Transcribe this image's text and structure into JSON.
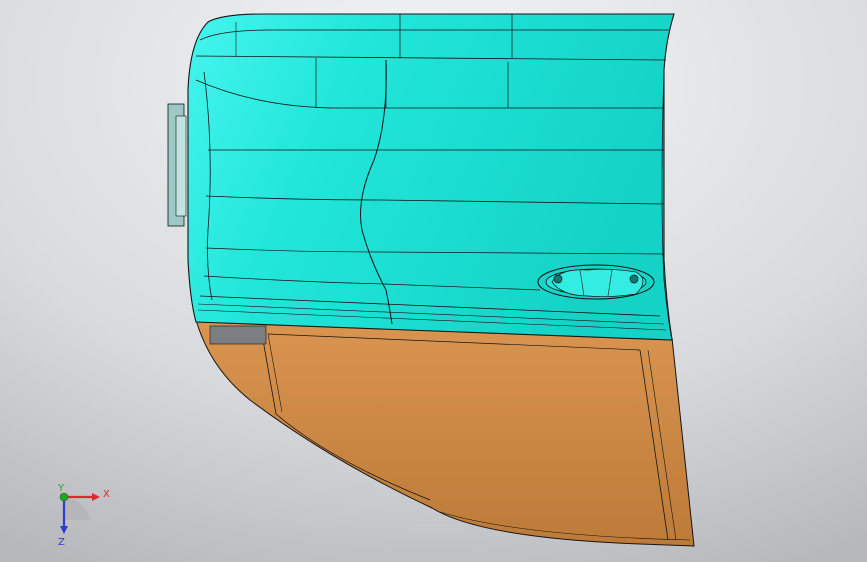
{
  "colors": {
    "background_light": "#f2f3f5",
    "background_dark": "#b9bbbf",
    "door_panel": "#1fe0d4",
    "door_panel_highlight": "#3cf2ea",
    "door_panel_shadow": "#0fc4b8",
    "trim_panel": "#d08a4a",
    "trim_panel_shadow": "#b87534",
    "edge_line": "#141414",
    "x_axis": "#e0282c",
    "y_axis": "#2aa12a",
    "z_axis": "#2c3ccc"
  },
  "triad": {
    "x_label": "X",
    "y_label": "Y",
    "z_label": "Z"
  }
}
